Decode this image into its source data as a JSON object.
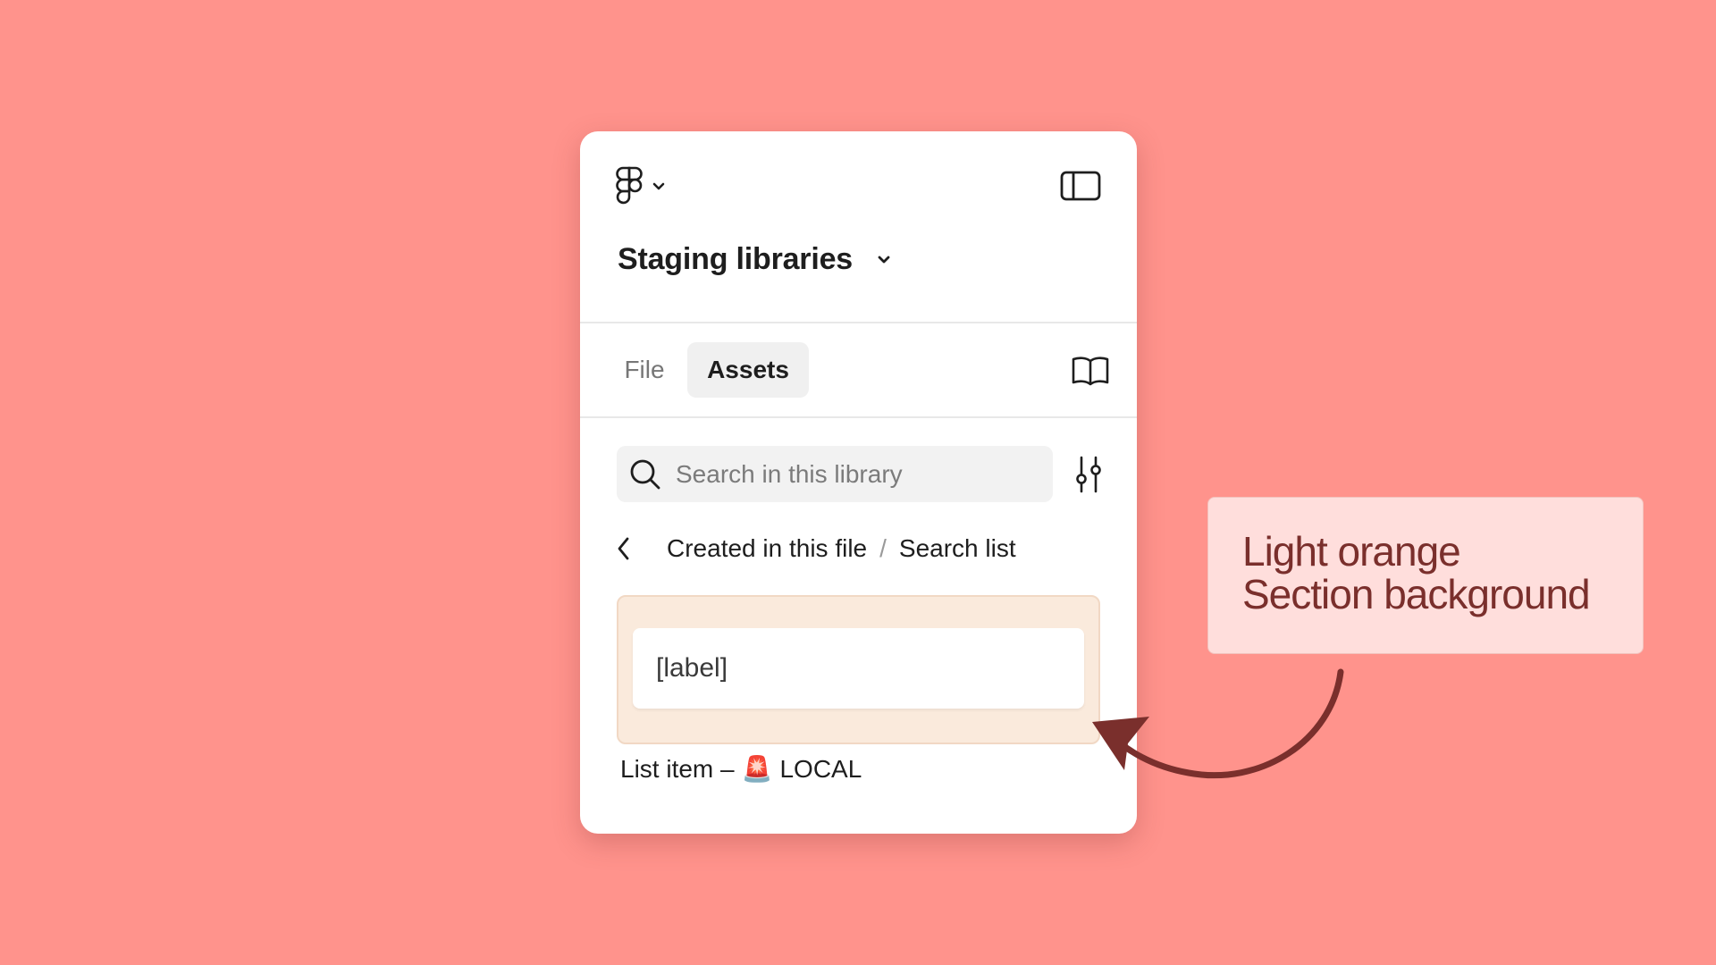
{
  "app": {
    "title": "Staging libraries"
  },
  "tabs": [
    {
      "label": "File",
      "active": false
    },
    {
      "label": "Assets",
      "active": true
    }
  ],
  "search": {
    "placeholder": "Search in this library",
    "value": ""
  },
  "breadcrumb": {
    "items": [
      "Created in this file",
      "Search list"
    ],
    "separator": "/"
  },
  "section": {
    "label_text": "[label]",
    "background_color": "#FAEADC"
  },
  "caption": {
    "text_prefix": "List item –",
    "emoji": "🚨",
    "text_suffix": "LOCAL"
  },
  "annotation": {
    "line1": "Light orange",
    "line2": "Section background"
  },
  "icons": [
    "figma-logo-icon",
    "chevron-down-icon",
    "sidebar-toggle-icon",
    "book-icon",
    "search-icon",
    "filter-sliders-icon",
    "chevron-left-icon"
  ],
  "colors": {
    "page_background": "#FF938C",
    "annotation_text": "#7A2F2C",
    "annotation_background": "#FFDEDC"
  }
}
